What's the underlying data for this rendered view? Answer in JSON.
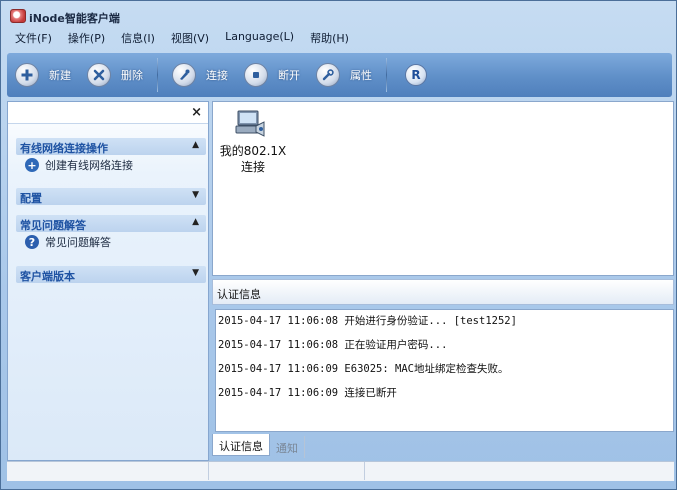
{
  "window": {
    "title": "iNode智能客户端"
  },
  "menu": [
    {
      "label": "文件(F)"
    },
    {
      "label": "操作(P)"
    },
    {
      "label": "信息(I)"
    },
    {
      "label": "视图(V)"
    },
    {
      "label": "Language(L)"
    },
    {
      "label": "帮助(H)"
    }
  ],
  "toolbar": {
    "new_label": "新建",
    "delete_label": "删除",
    "connect_label": "连接",
    "disconnect_label": "断开",
    "properties_label": "属性",
    "r_label": "R"
  },
  "sidebar": {
    "close": "×",
    "sections": [
      {
        "title": "有线网络连接操作",
        "expanded": true,
        "items": [
          {
            "label": "创建有线网络连接",
            "icon": "plus-circle-icon"
          }
        ]
      },
      {
        "title": "配置",
        "expanded": false,
        "items": []
      },
      {
        "title": "常见问题解答",
        "expanded": true,
        "items": [
          {
            "label": "常见问题解答",
            "icon": "help-circle-icon"
          }
        ]
      },
      {
        "title": "客户端版本",
        "expanded": false,
        "items": []
      }
    ],
    "arrow_up": "▲",
    "arrow_down": "▼"
  },
  "connection": {
    "line1": "我的802.1X",
    "line2": "连接",
    "icon": "network-computer-icon"
  },
  "auth": {
    "header": "认证信息",
    "log": [
      "2015-04-17 11:06:08 开始进行身份验证... [test1252]",
      "2015-04-17 11:06:08 正在验证用户密码...",
      "2015-04-17 11:06:09 E63025: MAC地址绑定检查失败。",
      "2015-04-17 11:06:09 连接已断开"
    ]
  },
  "tabs": [
    {
      "label": "认证信息",
      "active": true
    },
    {
      "label": "通知",
      "active": false
    }
  ],
  "colors": {
    "toolbar": "#5f8fc8",
    "section_title": "#1f53a3",
    "window_bg": "#a9c8ea"
  }
}
